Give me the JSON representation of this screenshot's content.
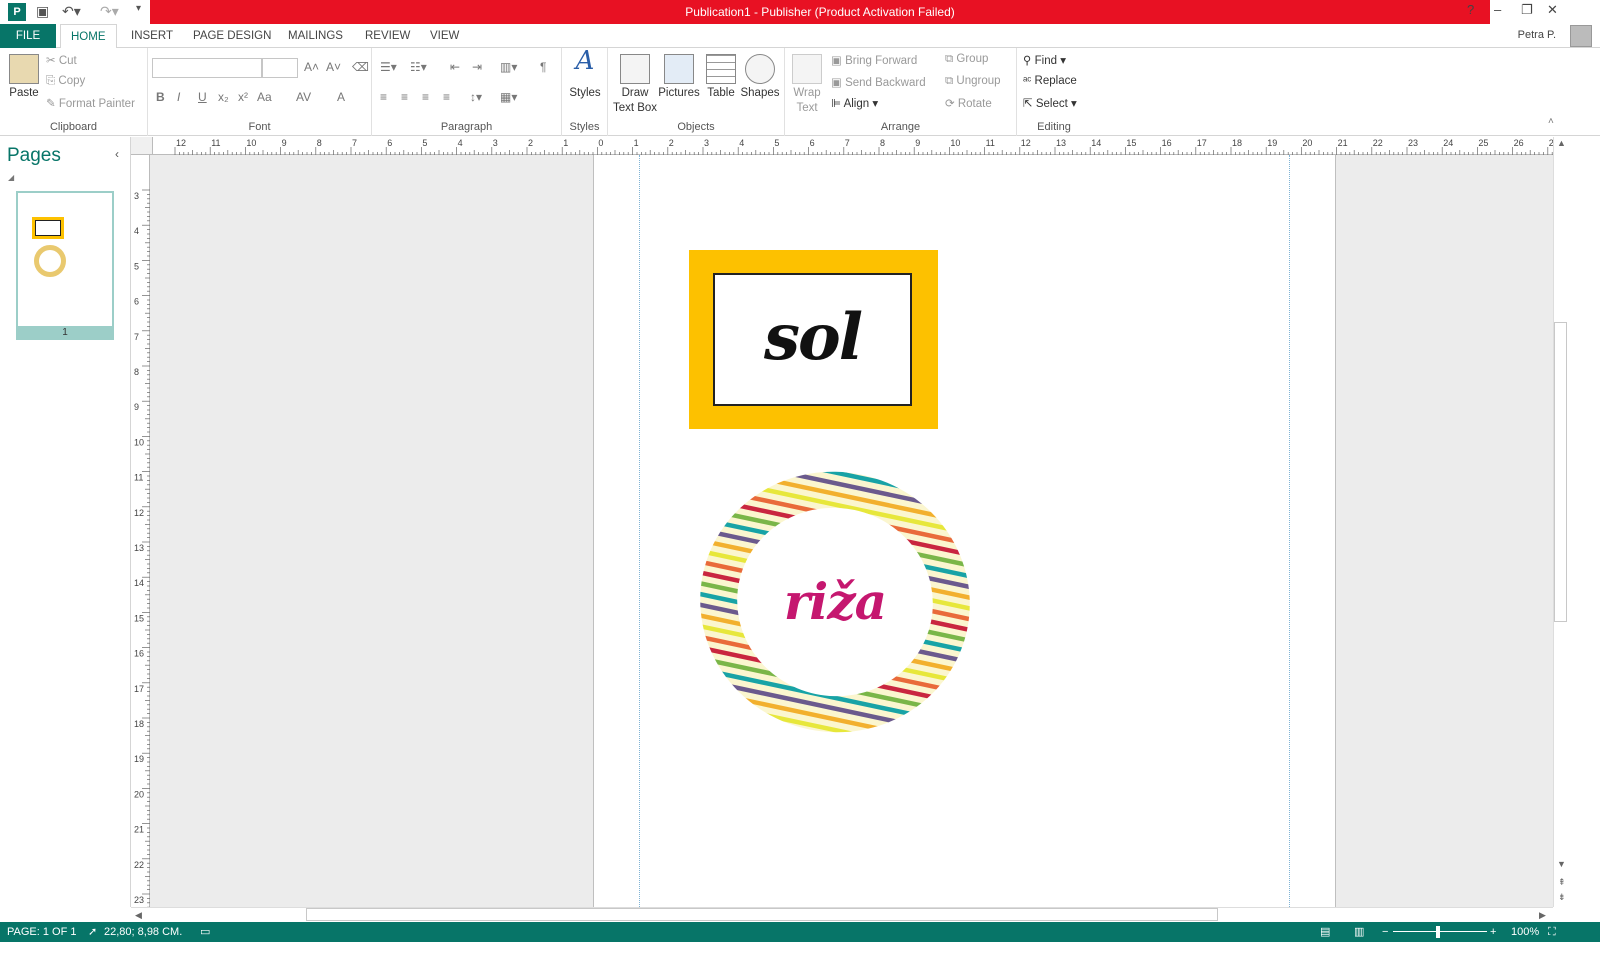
{
  "window": {
    "title": "Publication1 -  Publisher (Product Activation Failed)",
    "help": "?",
    "minimize": "–",
    "restore": "❐",
    "close": "✕"
  },
  "tabs": {
    "file": "FILE",
    "home": "HOME",
    "insert": "INSERT",
    "page_design": "PAGE DESIGN",
    "mailings": "MAILINGS",
    "review": "REVIEW",
    "view": "VIEW"
  },
  "user": "Petra P.",
  "ribbon": {
    "clipboard": {
      "label": "Clipboard",
      "paste": "Paste",
      "cut": "Cut",
      "copy": "Copy",
      "format_painter": "Format Painter"
    },
    "font": {
      "label": "Font",
      "bold": "B",
      "italic": "I",
      "underline": "U",
      "subscript": "x₂",
      "superscript": "x²",
      "change_case": "Aa",
      "font_color": "A",
      "spacing": "AV"
    },
    "paragraph": {
      "label": "Paragraph",
      "pilcrow": "¶"
    },
    "styles": {
      "label": "Styles",
      "styles": "Styles"
    },
    "objects": {
      "label": "Objects",
      "draw_text_box": "Draw Text Box",
      "pictures": "Pictures",
      "table": "Table",
      "shapes": "Shapes"
    },
    "arrange": {
      "label": "Arrange",
      "wrap_text": "Wrap Text",
      "bring_forward": "Bring Forward",
      "send_backward": "Send Backward",
      "align": "Align",
      "group": "Group",
      "ungroup": "Ungroup",
      "rotate": "Rotate"
    },
    "editing": {
      "label": "Editing",
      "find": "Find",
      "replace": "Replace",
      "select": "Select"
    }
  },
  "pages_pane": {
    "title": "Pages",
    "page_number": "1"
  },
  "ruler": {
    "h_ticks": [
      "12",
      "11",
      "10",
      "9",
      "8",
      "7",
      "6",
      "5",
      "4",
      "3",
      "2",
      "1",
      "0",
      "1",
      "2",
      "3",
      "4",
      "5",
      "6",
      "7",
      "8",
      "9",
      "10",
      "11",
      "12",
      "13",
      "14",
      "15",
      "16",
      "17",
      "18",
      "19",
      "20",
      "21",
      "22",
      "23",
      "24",
      "25",
      "26",
      "2"
    ],
    "v_ticks": [
      "3",
      "4",
      "5",
      "6",
      "7",
      "8",
      "9",
      "10",
      "11",
      "12",
      "13",
      "14",
      "15",
      "16",
      "17",
      "18",
      "19",
      "20",
      "21",
      "22",
      "23"
    ]
  },
  "document": {
    "label1_text": "sol",
    "label1_bg": "#fdc100",
    "label2_text": "riža",
    "label2_color": "#c5176f",
    "stripe_colors": [
      "#e7e73b",
      "#e96a3a",
      "#c9263f",
      "#7ab648",
      "#18a3a6",
      "#6b5a8d",
      "#f2b02e"
    ]
  },
  "status": {
    "page": "PAGE: 1 OF 1",
    "position": "22,80; 8,98 CM.",
    "zoom": "100%",
    "accent": "#077568"
  }
}
